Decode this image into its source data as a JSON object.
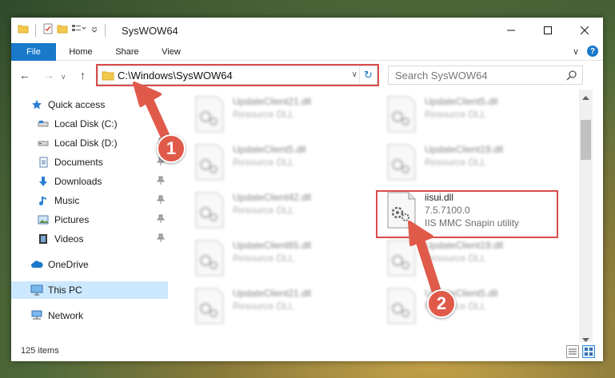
{
  "window": {
    "title": "SysWOW64",
    "caption": {
      "minimize": "—",
      "maximize": "☐",
      "close": "✕"
    }
  },
  "ribbon": {
    "tabs": [
      {
        "label": "File"
      },
      {
        "label": "Home"
      },
      {
        "label": "Share"
      },
      {
        "label": "View"
      }
    ],
    "expand_glyph": "∨",
    "help_glyph": "?"
  },
  "address": {
    "path": "C:\\Windows\\SysWOW64",
    "back": "←",
    "forward": "→",
    "recent": "∨",
    "up": "↑",
    "dropdown": "∨",
    "refresh": "↻"
  },
  "search": {
    "placeholder": "Search SysWOW64"
  },
  "nav": {
    "items": [
      {
        "label": "Quick access",
        "icon": "star-icon"
      },
      {
        "label": "Local Disk (C:)",
        "icon": "drive-icon"
      },
      {
        "label": "Local Disk (D:)",
        "icon": "drive-icon"
      },
      {
        "label": "Documents",
        "icon": "documents-icon"
      },
      {
        "label": "Downloads",
        "icon": "download-arrow-icon"
      },
      {
        "label": "Music",
        "icon": "music-note-icon"
      },
      {
        "label": "Pictures",
        "icon": "pictures-icon"
      },
      {
        "label": "Videos",
        "icon": "film-icon"
      },
      {
        "label": "OneDrive",
        "icon": "cloud-icon"
      },
      {
        "label": "This PC",
        "icon": "monitor-icon"
      },
      {
        "label": "Network",
        "icon": "network-icon"
      }
    ]
  },
  "files": {
    "left_column": [
      {
        "name": "UpdateClient21.dll",
        "type": "Resource DLL"
      },
      {
        "name": "UpdateClient5.dll",
        "type": "Resource DLL"
      },
      {
        "name": "UpdateClient42.dll",
        "type": "Resource DLL"
      },
      {
        "name": "UpdateClient65.dll",
        "type": "Resource DLL"
      },
      {
        "name": "UpdateClient21.dll",
        "type": "Resource DLL"
      }
    ],
    "right_column": [
      {
        "name": "UpdateClient5.dll",
        "type": "Resource DLL"
      },
      {
        "name": "UpdateClient19.dll",
        "type": "Resource DLL"
      },
      {
        "name": "UpdateClient19.dll",
        "type": "Resource DLL"
      },
      {
        "name": "UpdateClient5.dll",
        "type": "Resource DLL"
      }
    ],
    "highlighted": {
      "name": "iisui.dll",
      "version": "7.5.7100.0",
      "description": "IIS MMC Snapin utility"
    }
  },
  "status": {
    "item_count": "125 items"
  },
  "callouts": [
    {
      "number": "1"
    },
    {
      "number": "2"
    }
  ],
  "colors": {
    "accent": "#1979ca",
    "highlight_box": "#d94b4b",
    "badge": "#e05a4a",
    "selection": "#cce8ff"
  }
}
